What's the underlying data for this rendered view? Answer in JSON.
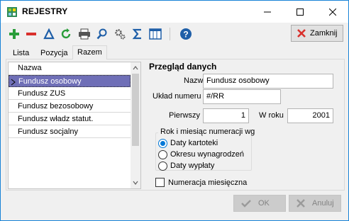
{
  "window": {
    "title": "REJESTRY"
  },
  "toolbar": {
    "close_label": "Zamknij",
    "icons": [
      "plus-icon",
      "minus-icon",
      "delta-icon",
      "refresh-icon",
      "printer-icon",
      "search-icon",
      "settings-icon",
      "sigma-icon",
      "columns-icon",
      "help-icon"
    ]
  },
  "tabs": [
    {
      "label": "Lista"
    },
    {
      "label": "Pozycja"
    },
    {
      "label": "Razem"
    }
  ],
  "list": {
    "header": "Nazwa",
    "items": [
      {
        "label": "Fundusz osobowy"
      },
      {
        "label": "Fundusz ZUS"
      },
      {
        "label": "Fundusz bezosobowy"
      },
      {
        "label": "Fundusz władz statut."
      },
      {
        "label": "Fundusz socjalny"
      }
    ]
  },
  "details": {
    "section_title": "Przegląd danych",
    "name_label": "Nazwa",
    "name_value": "Fundusz osobowy",
    "numbering_label": "Układ numeru",
    "numbering_value": "#/RR",
    "first_label": "Pierwszy",
    "first_value": "1",
    "year_label": "W roku",
    "year_value": "2001",
    "group_title": "Rok i miesiąc numeracji wg",
    "radios": [
      {
        "label": "Daty kartoteki",
        "selected": true
      },
      {
        "label": "Okresu wynagrodzeń",
        "selected": false
      },
      {
        "label": "Daty wypłaty",
        "selected": false
      }
    ],
    "monthly_label": "Numeracja miesięczna",
    "monthly_checked": false
  },
  "buttons": {
    "ok_label": "OK",
    "cancel_label": "Anuluj"
  },
  "colors": {
    "selection": "#6f6fb7",
    "accent": "#0078d7"
  }
}
